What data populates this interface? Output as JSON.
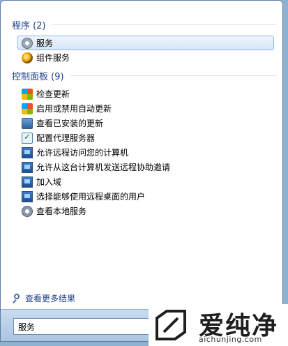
{
  "sections": [
    {
      "header": "程序 (2)",
      "items": [
        {
          "label": "服务",
          "icon": "services-gear-icon",
          "selected": true
        },
        {
          "label": "组件服务",
          "icon": "component-services-icon",
          "selected": false
        }
      ]
    },
    {
      "header": "控制面板 (9)",
      "items": [
        {
          "label": "检查更新",
          "icon": "windows-update-icon"
        },
        {
          "label": "启用或禁用自动更新",
          "icon": "windows-update-icon"
        },
        {
          "label": "查看已安装的更新",
          "icon": "installed-updates-icon"
        },
        {
          "label": "配置代理服务器",
          "icon": "proxy-check-icon"
        },
        {
          "label": "允许远程访问您的计算机",
          "icon": "remote-computer-icon"
        },
        {
          "label": "允许从这台计算机发送远程协助邀请",
          "icon": "remote-computer-icon"
        },
        {
          "label": "加入域",
          "icon": "remote-computer-icon"
        },
        {
          "label": "选择能够使用远程桌面的用户",
          "icon": "remote-computer-icon"
        },
        {
          "label": "查看本地服务",
          "icon": "services-gear-icon"
        }
      ]
    }
  ],
  "see_more": "查看更多结果",
  "search": {
    "value": "服务"
  },
  "watermark": {
    "brand": "爱纯净",
    "url": "aichunjing.com"
  },
  "colors": {
    "header": "#1e3f8a",
    "selection": "#d7e7f8",
    "taskbar": "#a9c4e2"
  }
}
